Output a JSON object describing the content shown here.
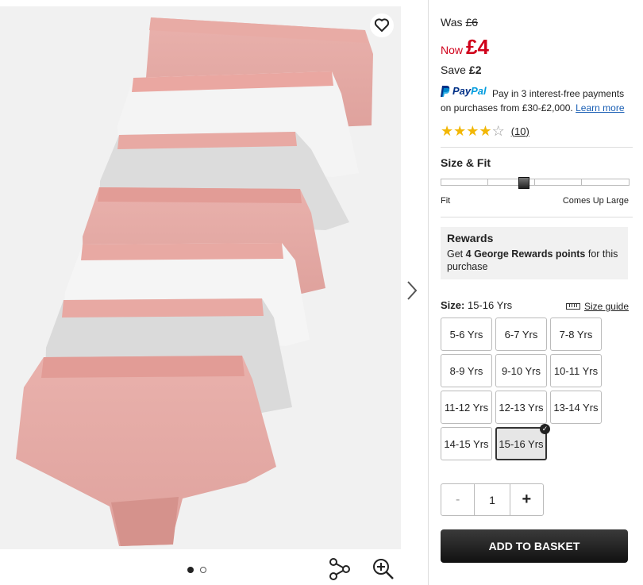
{
  "colors": {
    "price_red": "#d0021b",
    "paypal_blue": "#003087",
    "paypal_light": "#009cde",
    "star_gold": "#f2b705",
    "basket_bg": "#1a1a1a"
  },
  "gallery": {
    "wishlist_icon": "heart-icon",
    "next_icon": "chevron-right-icon",
    "share_icon": "share-icon",
    "zoom_icon": "zoom-in-icon",
    "dots_total": 2,
    "active_dot": 1
  },
  "price": {
    "was_label": "Was",
    "was_value": "£6",
    "now_label": "Now",
    "now_value": "£4",
    "save_label": "Save",
    "save_value": "£2"
  },
  "paypal": {
    "brand_pay": "Pay",
    "brand_pal": "Pal",
    "text": "Pay in 3 interest-free payments on purchases from £30-£2,000.",
    "link": "Learn more"
  },
  "rating": {
    "stars": 4,
    "max": 5,
    "count": "(10)"
  },
  "fit": {
    "title": "Size & Fit",
    "left_label": "Fit",
    "right_label": "Comes Up Large",
    "position": 0.45
  },
  "rewards": {
    "title": "Rewards",
    "text_pre": "Get",
    "points": "4 George Rewards points",
    "text_post": "for this purchase"
  },
  "size": {
    "label": "Size:",
    "selected": "15-16 Yrs",
    "guide": "Size guide",
    "options": [
      "5-6 Yrs",
      "6-7 Yrs",
      "7-8 Yrs",
      "8-9 Yrs",
      "9-10 Yrs",
      "10-11 Yrs",
      "11-12 Yrs",
      "12-13 Yrs",
      "13-14 Yrs",
      "14-15 Yrs",
      "15-16 Yrs"
    ]
  },
  "quantity": {
    "minus": "-",
    "value": "1",
    "plus": "+"
  },
  "basket": {
    "label": "ADD TO BASKET"
  }
}
